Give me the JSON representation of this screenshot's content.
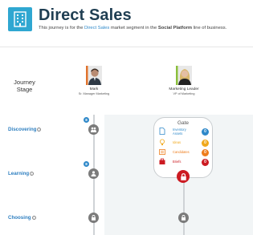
{
  "header": {
    "title": "Direct Sales",
    "subtitle_pre": "This journey is for the ",
    "subtitle_link": "Direct Sales",
    "subtitle_mid": " market segment in the ",
    "subtitle_bold": "Social Platform",
    "subtitle_post": " line of business.",
    "icon": "building-icon"
  },
  "journey_stage_label_1": "Journey",
  "journey_stage_label_2": "Stage",
  "personas": [
    {
      "name": "Mark",
      "role": "Sr. Manager Marketing",
      "accent": "#e0732d"
    },
    {
      "name": "Marketing Leader",
      "role": "VP of Marketing",
      "accent": "#8bbf3c"
    }
  ],
  "stages": [
    {
      "label": "Discovering",
      "badge": "8"
    },
    {
      "label": "Learning",
      "badge": "8"
    },
    {
      "label": "Choosing"
    }
  ],
  "gate": {
    "title": "Gate",
    "rows": [
      {
        "label_1": "Inventory",
        "label_2": "Assets",
        "count": "0",
        "color": "#2e88c9"
      },
      {
        "label_1": "Ideas",
        "label_2": "",
        "count": "0",
        "color": "#f0a81c"
      },
      {
        "label_1": "Candidates",
        "label_2": "",
        "count": "0",
        "color": "#ee7d1c"
      },
      {
        "label_1": "Briefs",
        "label_2": "",
        "count": "0",
        "color": "#cc1b22"
      }
    ]
  },
  "colors": {
    "accent": "#2fa7d1",
    "title": "#1f3e52",
    "link": "#2e88c9",
    "node": "#7b7b7b",
    "lock": "#cc1b22"
  }
}
